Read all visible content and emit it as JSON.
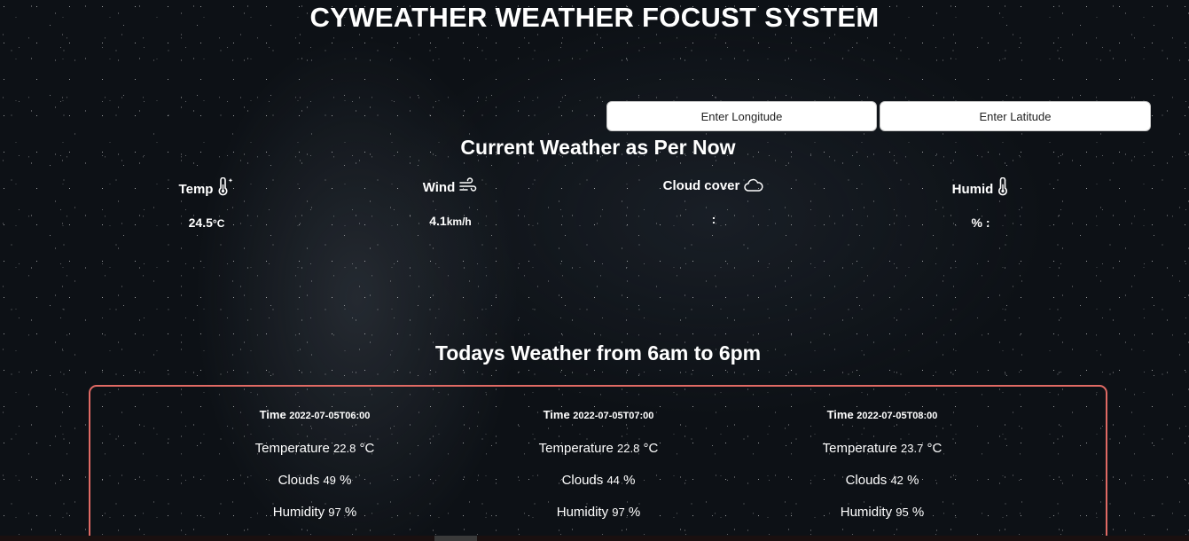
{
  "header": {
    "title": "CYWEATHER WEATHER FOCUST SYSTEM"
  },
  "inputs": {
    "longitude_placeholder": "Enter Longitude",
    "latitude_placeholder": "Enter Latitude"
  },
  "current": {
    "title": "Current Weather as Per Now",
    "metrics": [
      {
        "label": "Temp",
        "icon": "thermometer-sun-icon",
        "value": "24.5",
        "unit": "°C"
      },
      {
        "label": "Wind",
        "icon": "wind-icon",
        "value": "4.1",
        "unit": "km/h"
      },
      {
        "label": "Cloud cover",
        "icon": "cloud-icon",
        "value": ":",
        "unit": ""
      },
      {
        "label": "Humid",
        "icon": "thermometer-icon",
        "value": "% :",
        "unit": ""
      }
    ]
  },
  "today": {
    "title": "Todays Weather from 6am to 6pm",
    "time_label": "Time",
    "temperature_label": "Temperature",
    "temperature_unit": "°C",
    "clouds_label": "Clouds",
    "humidity_label": "Humidity",
    "percent_unit": "%",
    "forecasts": [
      {
        "time": "2022-07-05T06:00",
        "temperature": "22.8",
        "clouds": "49",
        "humidity": "97"
      },
      {
        "time": "2022-07-05T07:00",
        "temperature": "22.8",
        "clouds": "44",
        "humidity": "97"
      },
      {
        "time": "2022-07-05T08:00",
        "temperature": "23.7",
        "clouds": "42",
        "humidity": "95"
      }
    ]
  },
  "colors": {
    "panel_border": "#e06a64",
    "text": "#ffffff",
    "input_bg": "#ffffff"
  }
}
